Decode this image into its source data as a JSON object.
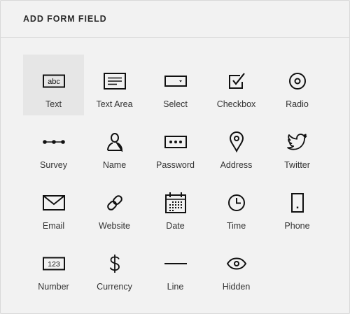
{
  "header": {
    "title": "ADD FORM FIELD"
  },
  "fields": [
    {
      "label": "Text",
      "icon": "text-field-icon",
      "selected": true
    },
    {
      "label": "Text Area",
      "icon": "textarea-icon"
    },
    {
      "label": "Select",
      "icon": "select-dropdown-icon"
    },
    {
      "label": "Checkbox",
      "icon": "checkbox-icon"
    },
    {
      "label": "Radio",
      "icon": "radio-button-icon"
    },
    {
      "label": "Survey",
      "icon": "survey-scale-icon"
    },
    {
      "label": "Name",
      "icon": "person-icon"
    },
    {
      "label": "Password",
      "icon": "password-dots-icon"
    },
    {
      "label": "Address",
      "icon": "map-pin-icon"
    },
    {
      "label": "Twitter",
      "icon": "twitter-bird-icon"
    },
    {
      "label": "Email",
      "icon": "envelope-icon"
    },
    {
      "label": "Website",
      "icon": "link-chain-icon"
    },
    {
      "label": "Date",
      "icon": "calendar-icon"
    },
    {
      "label": "Time",
      "icon": "clock-icon"
    },
    {
      "label": "Phone",
      "icon": "phone-icon"
    },
    {
      "label": "Number",
      "icon": "number-123-icon"
    },
    {
      "label": "Currency",
      "icon": "dollar-sign-icon"
    },
    {
      "label": "Line",
      "icon": "horizontal-line-icon"
    },
    {
      "label": "Hidden",
      "icon": "eye-icon"
    }
  ],
  "icon_glyphs": {
    "text_field": "abc",
    "number": "123"
  },
  "colors": {
    "background": "#f2f2f2",
    "selected_tile": "#e6e6e6",
    "icon_stroke": "#111111"
  }
}
